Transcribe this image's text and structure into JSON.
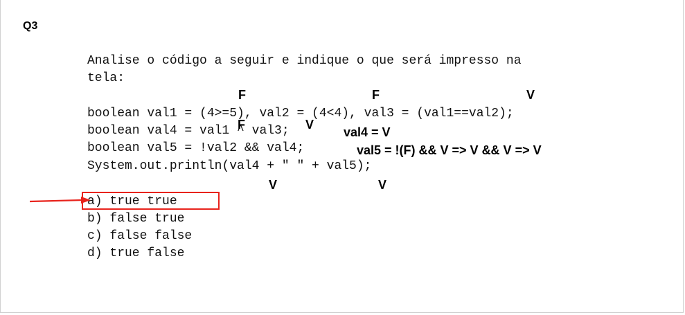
{
  "question": {
    "label": "Q3",
    "prompt_line1": "Analise o código a seguir e indique o que será impresso na",
    "prompt_line2": "tela:"
  },
  "code_lines": [
    "boolean val1 = (4>=5), val2 = (4<4), val3 = (val1==val2);",
    "boolean val4 = val1 ^ val3;",
    "boolean val5 = !val2 && val4;",
    "System.out.println(val4 + \" \" + val5);"
  ],
  "annotations": {
    "val1_result": "F",
    "val2_result": "F",
    "val3_result": "V",
    "val4_left": "F",
    "val4_right": "V",
    "val4_eval": "val4 = V",
    "val5_eval": "val5 = !(F) && V => V && V => V",
    "print_left": "V",
    "print_right": "V"
  },
  "options": [
    "a) true true",
    "b) false true",
    "c) false false",
    "d) true false"
  ],
  "highlight": {
    "selected_option": "a) true true",
    "color": "#e8231c"
  }
}
